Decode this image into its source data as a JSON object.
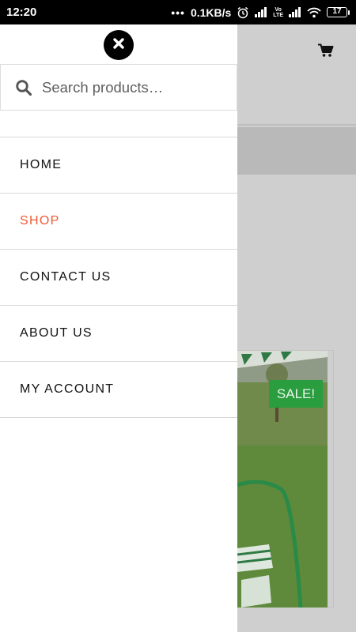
{
  "status_bar": {
    "time": "12:20",
    "dots": "•••",
    "net_speed": "0.1KB/s",
    "volte_line1": "Vo",
    "volte_line2": "LTE",
    "battery": "17"
  },
  "search": {
    "placeholder": "Search products…",
    "value": ""
  },
  "menu": {
    "items": [
      {
        "label": "HOME"
      },
      {
        "label": "SHOP"
      },
      {
        "label": "CONTACT US"
      },
      {
        "label": "ABOUT US"
      },
      {
        "label": "MY ACCOUNT"
      }
    ],
    "active_index": 1
  },
  "product": {
    "badge": "SALE!"
  },
  "colors": {
    "accent": "#ef5a36",
    "sale": "#2a9d3f",
    "overlay": "#cfcfcf"
  }
}
